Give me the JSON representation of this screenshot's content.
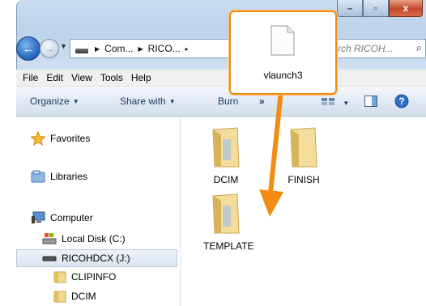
{
  "window": {
    "title_buttons": [
      "–",
      "▫",
      "x"
    ]
  },
  "nav": {
    "breadcrumbs": [
      "Com...",
      "RICO...",
      "▸"
    ],
    "search_placeholder": "rch RICOH...",
    "search_icon": "search-icon"
  },
  "menu": {
    "items": [
      {
        "label": "File"
      },
      {
        "label": "Edit"
      },
      {
        "label": "View"
      },
      {
        "label": "Tools"
      },
      {
        "label": "Help"
      }
    ]
  },
  "toolbar": {
    "organize_label": "Organize",
    "share_label": "Share with",
    "burn_label": "Burn",
    "more_label": "»"
  },
  "sidebar": {
    "favorites": "Favorites",
    "libraries": "Libraries",
    "computer": "Computer",
    "local_disk": "Local Disk (C:)",
    "removable": "RICOHDCX (J:)",
    "sub_clipinfo": "CLIPINFO",
    "sub_dcim": "DCIM"
  },
  "content": {
    "folders": [
      {
        "name": "DCIM"
      },
      {
        "name": "FINISH"
      },
      {
        "name": "TEMPLATE"
      }
    ]
  },
  "drag": {
    "file_name": "vlaunch3",
    "highlight_color": "#f28c12"
  }
}
